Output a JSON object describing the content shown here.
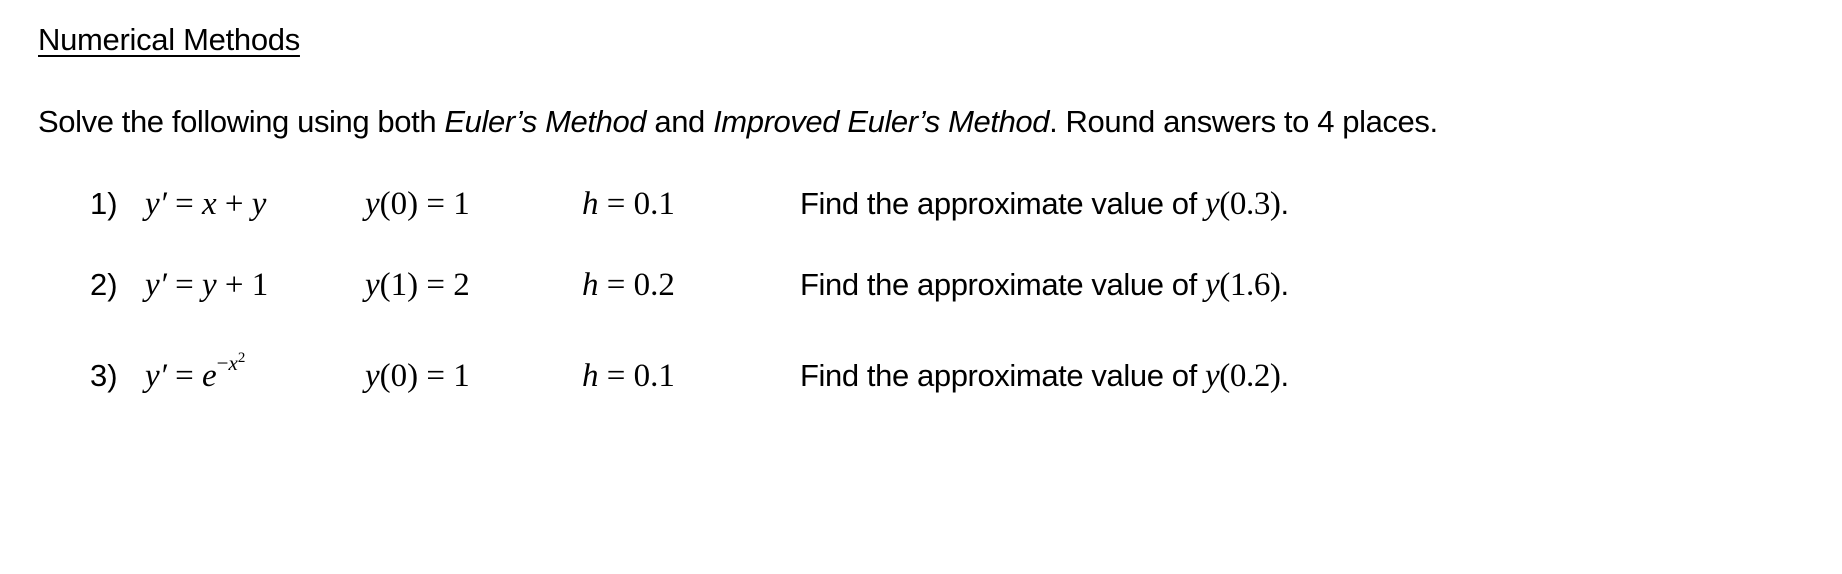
{
  "document": {
    "title": "Numerical Methods",
    "instructions": {
      "prefix": "Solve the following using both ",
      "method_1": "Euler’s Method",
      "connector": " and ",
      "method_2": "Improved Euler’s Method",
      "suffix": ". Round answers to 4 places."
    },
    "problems": [
      {
        "number": "1)",
        "equation": {
          "lhs": "y′",
          "op": " = ",
          "rhs_parts": [
            "x",
            " + ",
            "y"
          ]
        },
        "initial_condition": {
          "fn": "y",
          "arg": "(0)",
          "op": " = ",
          "value": "1"
        },
        "step": {
          "var": "h",
          "op": " = ",
          "value": "0.1"
        },
        "find": {
          "text": "Find the approximate value of ",
          "fn": "y",
          "arg": "(0.3)",
          "end": "."
        }
      },
      {
        "number": "2)",
        "equation": {
          "lhs": "y′",
          "op": " = ",
          "rhs_parts": [
            "y",
            " + ",
            "1"
          ]
        },
        "initial_condition": {
          "fn": "y",
          "arg": "(1)",
          "op": " = ",
          "value": "2"
        },
        "step": {
          "var": "h",
          "op": " = ",
          "value": "0.2"
        },
        "find": {
          "text": "Find the approximate value of ",
          "fn": "y",
          "arg": "(1.6)",
          "end": "."
        }
      },
      {
        "number": "3)",
        "equation": {
          "lhs": "y′",
          "op": " = ",
          "base": "e",
          "exp_sign": "−",
          "exp_var": "x",
          "exp_power": "2"
        },
        "initial_condition": {
          "fn": "y",
          "arg": "(0)",
          "op": " = ",
          "value": "1"
        },
        "step": {
          "var": "h",
          "op": " = ",
          "value": "0.1"
        },
        "find": {
          "text": "Find the approximate value of ",
          "fn": "y",
          "arg": "(0.2)",
          "end": "."
        }
      }
    ]
  }
}
